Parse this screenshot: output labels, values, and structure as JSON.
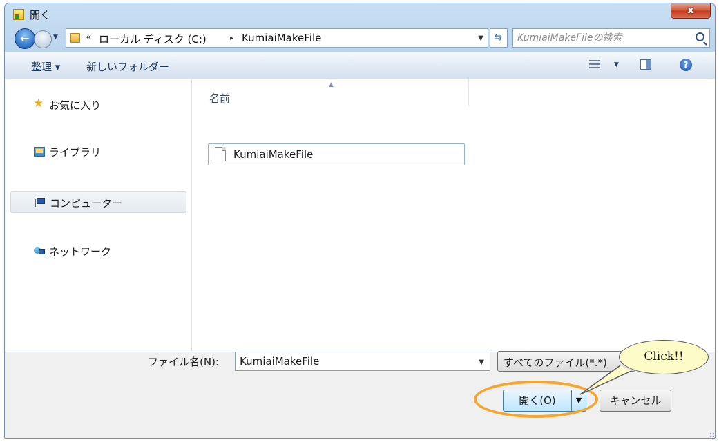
{
  "window": {
    "title": "開く",
    "close_label": "x"
  },
  "address": {
    "chevron": "«",
    "segments": [
      "ローカル ディスク (C:)",
      "KumiaiMakeFile"
    ],
    "separator": "▸"
  },
  "search": {
    "placeholder": "KumiaiMakeFileの検索"
  },
  "toolbar": {
    "organize": "整理 ▾",
    "new_folder": "新しいフォルダー"
  },
  "nav": {
    "items": [
      {
        "label": "お気に入り",
        "icon": "star-icon"
      },
      {
        "label": "ライブラリ",
        "icon": "library-icon"
      },
      {
        "label": "コンピューター",
        "icon": "computer-icon",
        "selected": true
      },
      {
        "label": "ネットワーク",
        "icon": "network-icon"
      }
    ]
  },
  "file_list": {
    "columns": [
      "名前"
    ],
    "rows": [
      {
        "name": "KumiaiMakeFile",
        "icon": "document-icon"
      }
    ]
  },
  "footer": {
    "file_name_label": "ファイル名(N):",
    "file_name_value": "KumiaiMakeFile",
    "file_type": "すべてのファイル(*.*)",
    "open_label": "開く(O)",
    "cancel_label": "キャンセル"
  },
  "annotation": {
    "callout_text": "Click!!",
    "highlight_color": "#f5a42e",
    "callout_fill": "#fdfbc8"
  }
}
